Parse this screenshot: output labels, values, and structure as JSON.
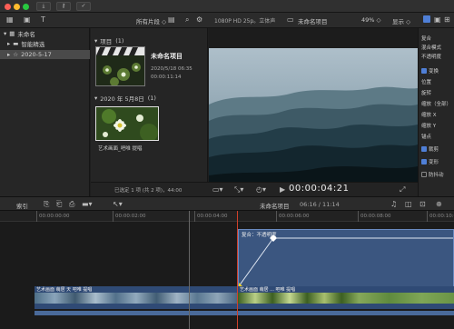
{
  "titlebar": {
    "icons": [
      "import-icon",
      "key-icon",
      "check-icon"
    ]
  },
  "toolbar": {
    "filter_label": "所有片段",
    "format_info": "1080P HD 25p。立体声",
    "project_name": "未命名项目",
    "zoom": "49%",
    "view_label": "显示"
  },
  "sidebar": {
    "library": "未命名",
    "items": [
      {
        "label": "智能精选"
      },
      {
        "label": "2020-5-17"
      }
    ]
  },
  "browser": {
    "project_section": "项目",
    "project_count": "(1)",
    "project_title": "未命名项目",
    "project_date": "2020/5/18 06:35",
    "project_duration": "00:00:11:14",
    "date_section": "2020 年 5月8日",
    "date_count": "(1)",
    "clip_name": "艺术画面_吧唯 提唱",
    "status": "已选定 1 项 (共 2 项)，44:00"
  },
  "viewer": {
    "timecode": "00:00:04:21"
  },
  "inspector": {
    "rows": [
      {
        "label": "复合",
        "check": "none"
      },
      {
        "label": "混合模式",
        "check": "none"
      },
      {
        "label": "不透明度",
        "check": "none"
      },
      {
        "label": "变换",
        "check": "on"
      },
      {
        "label": "位置",
        "check": "none"
      },
      {
        "label": "旋转",
        "check": "none"
      },
      {
        "label": "缩放（全部）",
        "check": "none"
      },
      {
        "label": "缩放 X",
        "check": "none"
      },
      {
        "label": "缩放 Y",
        "check": "none"
      },
      {
        "label": "锚点",
        "check": "none"
      },
      {
        "label": "裁剪",
        "check": "on"
      },
      {
        "label": "变形",
        "check": "on"
      },
      {
        "label": "防抖动",
        "check": "off"
      }
    ]
  },
  "timeline_bar": {
    "index_label": "索引",
    "project_name": "未命名项目",
    "position": "06:16 / 11:14"
  },
  "timeline": {
    "ruler": [
      "00:00:00:00",
      "00:00:02:00",
      "00:00:04:00",
      "00:00:06:00",
      "00:00:08:00",
      "00:00:10:00"
    ],
    "overlay_clip_label": "复合：不透明度",
    "main_clip_label": "艺术画面 萌居 天 吧唯 提唱",
    "second_clip_label": "艺术画面 萌居 ... 吧唯 提唱"
  },
  "colors": {
    "accent": "#4f7fd6",
    "playhead": "#d0402a",
    "keyframe": "#f0d020"
  }
}
